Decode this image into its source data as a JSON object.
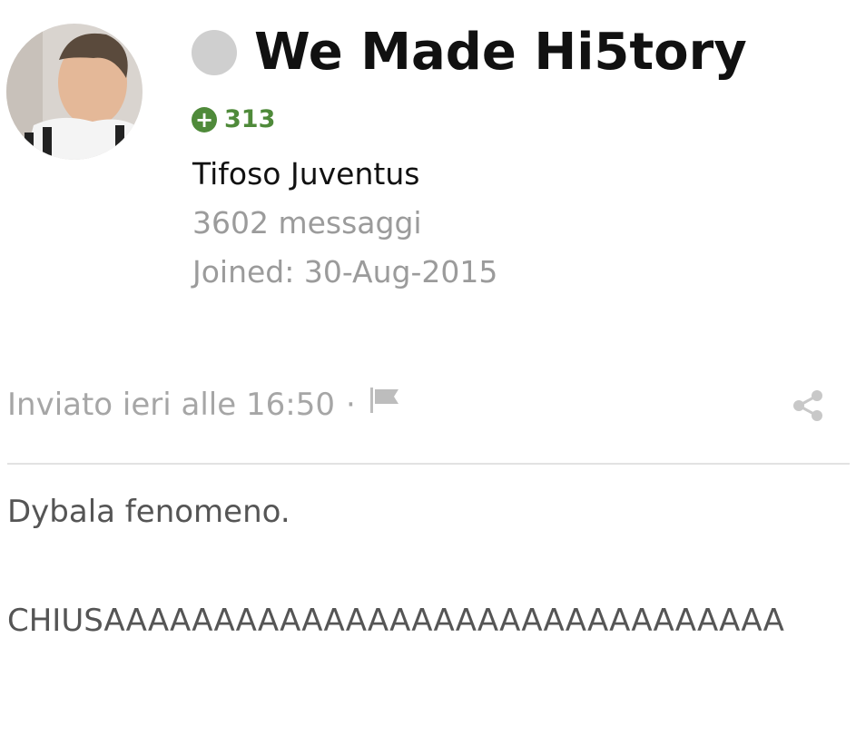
{
  "profile": {
    "username": "We Made Hi5tory",
    "reputation": "313",
    "member_title": "Tifoso Juventus",
    "post_count": "3602 messaggi",
    "joined": "Joined: 30-Aug-2015",
    "status_color": "#cfcfcf",
    "reputation_color": "#4f8a3a"
  },
  "post": {
    "meta": "Inviato ieri alle 16:50",
    "separator": "·",
    "flag_icon": "flag-icon",
    "share_icon": "share-icon",
    "body_line1": "Dybala fenomeno.",
    "body_line2": "CHIUSAAAAAAAAAAAAAAAAAAAAAAAAAAAAAAA"
  }
}
